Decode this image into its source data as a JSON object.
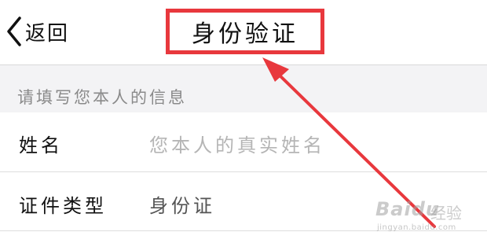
{
  "navbar": {
    "back_label": "返回",
    "title": "身份验证"
  },
  "section": {
    "header": "请填写您本人的信息"
  },
  "form": {
    "name": {
      "label": "姓名",
      "placeholder": "您本人的真实姓名"
    },
    "id_type": {
      "label": "证件类型",
      "value": "身份证"
    }
  },
  "annotation": {
    "highlight_color": "#e8383d"
  },
  "watermark": {
    "brand": "Baidu",
    "product": "经验",
    "url": "jingyan.baidu.com"
  }
}
